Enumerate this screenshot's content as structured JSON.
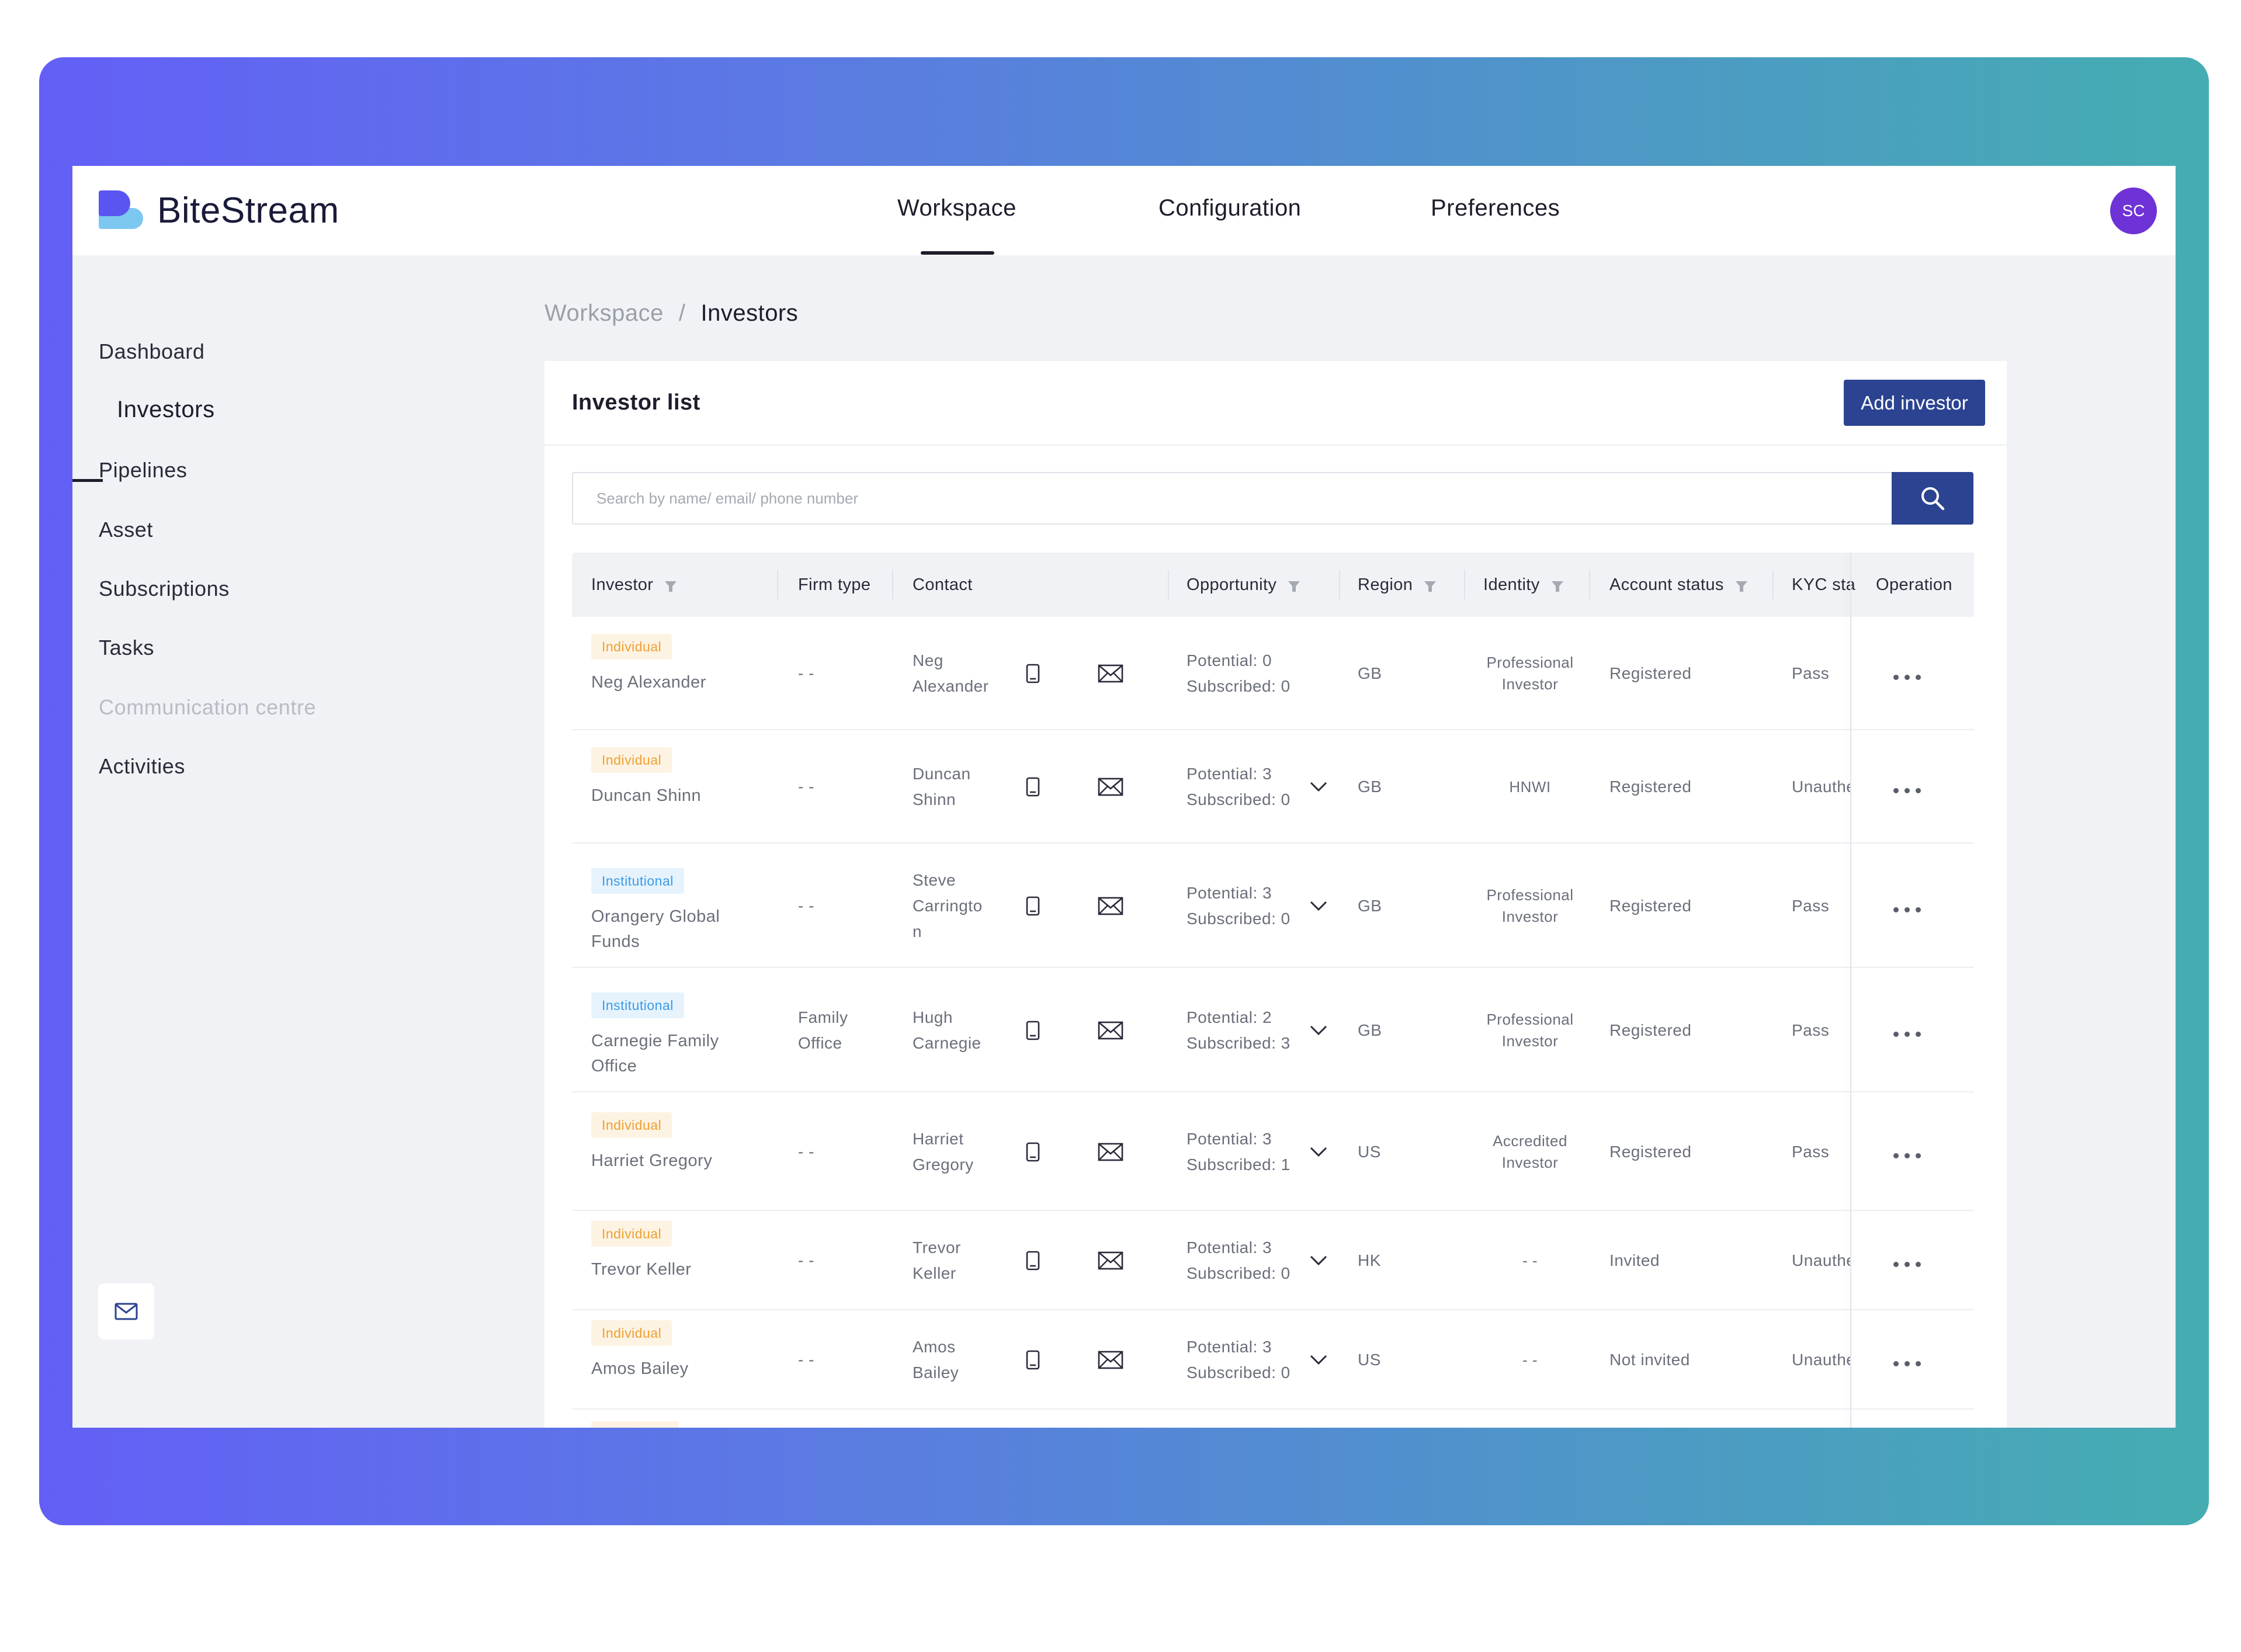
{
  "brand": {
    "name": "BiteStream"
  },
  "topnav": {
    "tabs": [
      {
        "label": "Workspace"
      },
      {
        "label": "Configuration"
      },
      {
        "label": "Preferences"
      }
    ]
  },
  "user": {
    "initials": "SC"
  },
  "sidebar": {
    "items": [
      {
        "label": "Dashboard"
      },
      {
        "label": "Investors"
      },
      {
        "label": "Pipelines"
      },
      {
        "label": "Asset"
      },
      {
        "label": "Subscriptions"
      },
      {
        "label": "Tasks"
      },
      {
        "label": "Communication centre"
      },
      {
        "label": "Activities"
      }
    ]
  },
  "breadcrumb": {
    "parent": "Workspace",
    "separator": "/",
    "current": "Investors"
  },
  "card": {
    "title": "Investor list",
    "add_button": "Add investor",
    "search_placeholder": "Search by name/ email/ phone number"
  },
  "table": {
    "headers": {
      "investor": "Investor",
      "firm_type": "Firm type",
      "contact": "Contact",
      "opportunity": "Opportunity",
      "region": "Region",
      "identity": "Identity",
      "account_status": "Account status",
      "kyc": "KYC sta",
      "operation": "Operation"
    },
    "rows": [
      {
        "type": "Individual",
        "name_l1": "Neg Alexander",
        "name_l2": "",
        "firm": "- -",
        "firm_l2": "",
        "contact_l1": "Neg",
        "contact_l2": "Alexander",
        "contact_l3": "",
        "potential": "Potential: 0",
        "subscribed": "Subscribed: 0",
        "region": "GB",
        "identity_l1": "Professional",
        "identity_l2": "Investor",
        "status": "Registered",
        "kyc": "Pass"
      },
      {
        "type": "Individual",
        "name_l1": "Duncan Shinn",
        "name_l2": "",
        "firm": "- -",
        "firm_l2": "",
        "contact_l1": "Duncan",
        "contact_l2": "Shinn",
        "contact_l3": "",
        "potential": "Potential: 3",
        "subscribed": "Subscribed: 0",
        "region": "GB",
        "identity_l1": "HNWI",
        "identity_l2": "",
        "status": "Registered",
        "kyc": "Unauthe"
      },
      {
        "type": "Institutional",
        "name_l1": "Orangery Global",
        "name_l2": "Funds",
        "firm": "- -",
        "firm_l2": "",
        "contact_l1": "Steve",
        "contact_l2": "Carringto",
        "contact_l3": "n",
        "potential": "Potential: 3",
        "subscribed": "Subscribed: 0",
        "region": "GB",
        "identity_l1": "Professional",
        "identity_l2": "Investor",
        "status": "Registered",
        "kyc": "Pass"
      },
      {
        "type": "Institutional",
        "name_l1": "Carnegie Family",
        "name_l2": "Office",
        "firm": "Family",
        "firm_l2": "Office",
        "contact_l1": "Hugh",
        "contact_l2": "Carnegie",
        "contact_l3": "",
        "potential": "Potential: 2",
        "subscribed": "Subscribed: 3",
        "region": "GB",
        "identity_l1": "Professional",
        "identity_l2": "Investor",
        "status": "Registered",
        "kyc": "Pass"
      },
      {
        "type": "Individual",
        "name_l1": "Harriet Gregory",
        "name_l2": "",
        "firm": "- -",
        "firm_l2": "",
        "contact_l1": "Harriet",
        "contact_l2": "Gregory",
        "contact_l3": "",
        "potential": "Potential: 3",
        "subscribed": "Subscribed: 1",
        "region": "US",
        "identity_l1": "Accredited",
        "identity_l2": "Investor",
        "status": "Registered",
        "kyc": "Pass"
      },
      {
        "type": "Individual",
        "name_l1": "Trevor Keller",
        "name_l2": "",
        "firm": "- -",
        "firm_l2": "",
        "contact_l1": "Trevor",
        "contact_l2": "Keller",
        "contact_l3": "",
        "potential": "Potential: 3",
        "subscribed": "Subscribed: 0",
        "region": "HK",
        "identity_l1": "- -",
        "identity_l2": "",
        "status": "Invited",
        "kyc": "Unauthe"
      },
      {
        "type": "Individual",
        "name_l1": "Amos Bailey",
        "name_l2": "",
        "firm": "- -",
        "firm_l2": "",
        "contact_l1": "Amos",
        "contact_l2": "Bailey",
        "contact_l3": "",
        "potential": "Potential: 3",
        "subscribed": "Subscribed: 0",
        "region": "US",
        "identity_l1": "- -",
        "identity_l2": "",
        "status": "Not invited",
        "kyc": "Unauthe"
      }
    ]
  },
  "colors": {
    "primary": "#2b4390",
    "individual_badge": "#f0a030",
    "institutional_badge": "#3a9ae8",
    "avatar": "#6e33d6",
    "gradient_start": "#635ff6",
    "gradient_end": "#45adb2"
  },
  "icons": {
    "phone": "phone-icon",
    "email": "envelope-icon",
    "search": "search-icon",
    "filter": "filter-icon",
    "expand": "chevron-down-icon",
    "more": "more-dots-icon",
    "mail": "mail-icon"
  }
}
